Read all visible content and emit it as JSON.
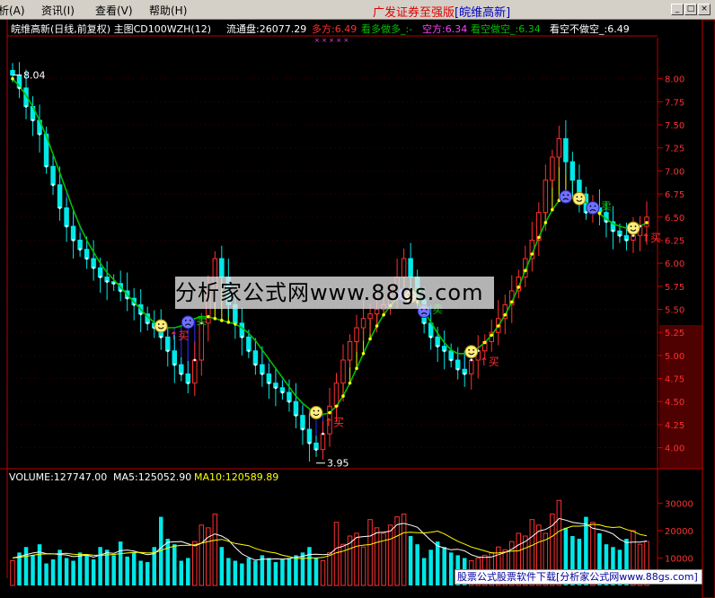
{
  "menu": {
    "items": [
      "析(A)",
      "资讯(I)",
      "查看(V)",
      "帮助(H)"
    ]
  },
  "broker": {
    "name": "广发证券至强版",
    "stock_tag": "[皖维高新]"
  },
  "window_buttons": [
    "_",
    "□",
    "×"
  ],
  "indicator_header": {
    "stock_label": "皖维高新(日线,前复权) 主图CD100WZH(12)",
    "float_shares": "流通盘:26077.29",
    "long": "多方:6.49",
    "watch_long": "看多做多_:-",
    "short": "空方:6.34",
    "watch_short": "看空做空_:6.34",
    "watch_none": "看空不做空_:6.49",
    "cross_marks": "×  ×  ×  ×  ×"
  },
  "volume_header": {
    "volume": "VOLUME:127747.00",
    "ma5": "MA5:125052.90",
    "ma10": "MA10:120589.89"
  },
  "annotations": {
    "high": "8.04",
    "low": "3.95",
    "buy_label": "↑买",
    "sell_label": "卖"
  },
  "watermark": {
    "text": "分析家公式网www.88gs.com"
  },
  "footer": {
    "text": "股票公式股票软件下载[分析家公式网www.88gs.com]"
  },
  "colors": {
    "up": "#ff3030",
    "down": "#00e8e8",
    "ma_green": "#00c000",
    "support_yellow": "#ffff00",
    "fill_blue": "#3030ff",
    "axis_red": "#c00000",
    "ma5": "#ffffff",
    "ma10": "#ffff00"
  },
  "chart_data": [
    {
      "type": "candlestick",
      "y_ticks": [
        4.0,
        4.25,
        4.5,
        4.75,
        5.0,
        5.25,
        5.5,
        5.75,
        6.0,
        6.25,
        6.5,
        6.75,
        7.0,
        7.25,
        7.5,
        7.75,
        8.0
      ],
      "ylim": [
        3.85,
        8.25
      ],
      "close": [
        8.04,
        7.9,
        7.7,
        7.55,
        7.4,
        7.05,
        6.85,
        6.6,
        6.4,
        6.25,
        6.15,
        6.05,
        5.95,
        5.85,
        5.8,
        5.78,
        5.7,
        5.62,
        5.55,
        5.45,
        5.35,
        5.3,
        5.2,
        5.05,
        4.9,
        4.8,
        4.7,
        4.95,
        5.35,
        5.7,
        6.05,
        5.85,
        5.55,
        5.35,
        5.2,
        5.05,
        4.9,
        4.8,
        4.7,
        4.65,
        4.6,
        4.5,
        4.35,
        4.2,
        4.05,
        3.98,
        4.15,
        4.45,
        4.7,
        4.95,
        5.15,
        5.3,
        5.4,
        5.45,
        5.5,
        5.55,
        5.65,
        5.85,
        6.05,
        5.85,
        5.6,
        5.35,
        5.2,
        5.1,
        5.05,
        4.95,
        4.85,
        4.8,
        4.95,
        5.05,
        5.15,
        5.25,
        5.4,
        5.55,
        5.7,
        5.85,
        6.05,
        6.25,
        6.55,
        6.9,
        7.15,
        7.35,
        7.1,
        6.9,
        6.75,
        6.55,
        6.6,
        6.55,
        6.45,
        6.35,
        6.3,
        6.25,
        6.3,
        6.4,
        6.5
      ],
      "ma_line": [
        8.0,
        7.92,
        7.82,
        7.7,
        7.55,
        7.38,
        7.18,
        6.98,
        6.78,
        6.58,
        6.4,
        6.25,
        6.12,
        6.0,
        5.9,
        5.82,
        5.74,
        5.66,
        5.58,
        5.5,
        5.42,
        5.36,
        5.32,
        5.3,
        5.3,
        5.32,
        5.36,
        5.4,
        5.42,
        5.42,
        5.4,
        5.38,
        5.36,
        5.34,
        5.3,
        5.24,
        5.16,
        5.06,
        4.96,
        4.86,
        4.76,
        4.66,
        4.56,
        4.48,
        4.42,
        4.38,
        4.36,
        4.38,
        4.45,
        4.56,
        4.7,
        4.86,
        5.02,
        5.18,
        5.32,
        5.44,
        5.54,
        5.62,
        5.66,
        5.64,
        5.58,
        5.48,
        5.36,
        5.24,
        5.14,
        5.06,
        5.02,
        5.02,
        5.04,
        5.08,
        5.14,
        5.22,
        5.32,
        5.44,
        5.58,
        5.74,
        5.92,
        6.1,
        6.28,
        6.44,
        6.58,
        6.68,
        6.72,
        6.72,
        6.7,
        6.66,
        6.6,
        6.54,
        6.48,
        6.43,
        6.4,
        6.38,
        6.38,
        6.4,
        6.44
      ],
      "events": [
        {
          "index": 22,
          "kind": "smile",
          "label": "buy"
        },
        {
          "index": 26,
          "kind": "frown",
          "label": "sell"
        },
        {
          "index": 45,
          "kind": "smile",
          "label": "buy"
        },
        {
          "index": 58,
          "kind": "frown",
          "label": "sell"
        },
        {
          "index": 59,
          "kind": "smile",
          "label": "none"
        },
        {
          "index": 61,
          "kind": "frown",
          "label": "sell"
        },
        {
          "index": 68,
          "kind": "smile",
          "label": "buy"
        },
        {
          "index": 82,
          "kind": "frown",
          "label": "none"
        },
        {
          "index": 84,
          "kind": "smile",
          "label": "none"
        },
        {
          "index": 86,
          "kind": "frown",
          "label": "sell"
        },
        {
          "index": 92,
          "kind": "smile",
          "label": "buy"
        }
      ]
    },
    {
      "type": "bar",
      "y_ticks": [
        10000,
        20000,
        30000
      ],
      "ylim": [
        0,
        36000
      ],
      "volume": [
        9000,
        12000,
        14000,
        11000,
        15000,
        8000,
        9500,
        13000,
        10000,
        9000,
        12000,
        11000,
        9500,
        14000,
        13000,
        11000,
        16000,
        10500,
        12000,
        9000,
        8500,
        14000,
        25000,
        17000,
        15000,
        9000,
        10000,
        16000,
        22000,
        21000,
        26000,
        14000,
        10000,
        9000,
        8000,
        10000,
        9000,
        11000,
        10000,
        8500,
        9500,
        10000,
        11000,
        12000,
        14000,
        10000,
        9000,
        12000,
        23000,
        15000,
        18000,
        19000,
        14000,
        24000,
        21000,
        19000,
        22000,
        25000,
        26000,
        18000,
        15000,
        10000,
        13000,
        16000,
        14000,
        12000,
        11000,
        10000,
        9000,
        10000,
        11000,
        12000,
        14000,
        13000,
        16000,
        19000,
        18000,
        24000,
        22000,
        19000,
        26000,
        31000,
        21000,
        18000,
        17000,
        25000,
        23000,
        19000,
        15000,
        14000,
        13000,
        17000,
        20000,
        15000,
        16000
      ],
      "ma5": [
        10000,
        10500,
        11200,
        11800,
        12200,
        11600,
        11500,
        11300,
        11100,
        10500,
        10700,
        11100,
        10300,
        11100,
        11900,
        11700,
        12700,
        12900,
        12500,
        11800,
        11200,
        11600,
        13700,
        15700,
        15900,
        16000,
        15200,
        14400,
        15400,
        17600,
        18800,
        18000,
        16600,
        13800,
        11500,
        10200,
        9200,
        9600,
        9600,
        9700,
        9600,
        9800,
        10200,
        10600,
        11300,
        11400,
        11200,
        11400,
        13600,
        14300,
        15400,
        17500,
        17800,
        18000,
        19200,
        19400,
        19800,
        22200,
        22600,
        22000,
        21200,
        18800,
        16400,
        14400,
        13600,
        13000,
        13200,
        12600,
        11200,
        10400,
        10200,
        10400,
        11200,
        12000,
        13200,
        14800,
        16000,
        17800,
        19800,
        20400,
        21800,
        24400,
        23800,
        23000,
        22600,
        22400,
        20800,
        20400,
        19800,
        18800,
        16800,
        15600,
        15800,
        15800,
        16200
      ],
      "ma10": [
        10000,
        10200,
        10600,
        11000,
        11400,
        11500,
        11500,
        11600,
        11700,
        11400,
        11200,
        11300,
        11000,
        11000,
        11100,
        11300,
        11600,
        11800,
        12000,
        12000,
        11800,
        11900,
        12700,
        13700,
        14300,
        14600,
        14600,
        14800,
        15400,
        16000,
        16500,
        16800,
        16100,
        15300,
        14900,
        14500,
        13500,
        12700,
        12200,
        11800,
        11000,
        10500,
        9900,
        9800,
        10000,
        10000,
        10200,
        10900,
        11900,
        12500,
        13400,
        14300,
        14700,
        14900,
        15700,
        16300,
        16900,
        18000,
        19200,
        19400,
        19200,
        19100,
        19400,
        19800,
        18800,
        17400,
        16100,
        15100,
        14000,
        13300,
        12600,
        11800,
        11800,
        12200,
        12500,
        12600,
        13600,
        14600,
        15800,
        16600,
        17900,
        19800,
        20800,
        21600,
        21600,
        21800,
        22300,
        22100,
        21400,
        21100,
        21300,
        20400,
        19700,
        18600,
        18100
      ]
    }
  ]
}
